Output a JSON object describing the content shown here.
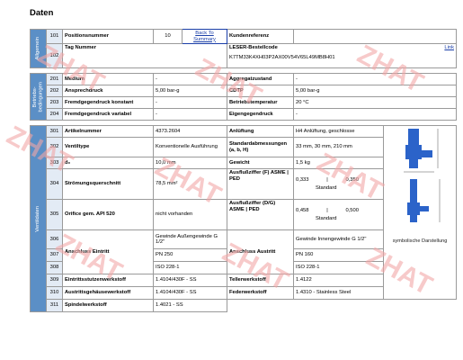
{
  "heading": "Daten",
  "watermark": "ZHAT",
  "groups": {
    "allgemein": "Allgemein",
    "betrieb": "Betriebs-\nbedingungen",
    "ventildaten": "Ventildaten"
  },
  "rows": {
    "r101": {
      "num": "101",
      "label": "Positionsnummer",
      "value": "10",
      "button": "Back To Summary",
      "label2": "Kundenreferenz",
      "value2": ""
    },
    "r102": {
      "num": "102",
      "label": "Tag Nummer",
      "value": "",
      "label2": "LESER-Bestellcode",
      "link": "Link",
      "value2": "K7TM33K4XH03P2AX00V54V65L49MB8H01"
    },
    "r201": {
      "num": "201",
      "label": "Medium",
      "value": "-",
      "label2": "Aggregatzustand",
      "value2": "-"
    },
    "r202": {
      "num": "202",
      "label": "Ansprechdruck",
      "value": "5,00 bar-g",
      "label2": "CDTP",
      "value2": "5,00 bar-g"
    },
    "r203": {
      "num": "203",
      "label": "Fremdgegendruck konstant",
      "value": "-",
      "label2": "Betriebstemperatur",
      "value2": "20 °C"
    },
    "r204": {
      "num": "204",
      "label": "Fremdgegendruck variabel",
      "value": "-",
      "label2": "Eigengegendruck",
      "value2": "-"
    },
    "r301": {
      "num": "301",
      "label": "Artikelnummer",
      "value": "4373.2604",
      "label2": "Anlüftung",
      "value2": "H4 Anlüftung, geschlosse"
    },
    "r302": {
      "num": "302",
      "label": "Ventiltype",
      "value": "Konventionelle Ausführung",
      "label2": "Standardabmessungen (a, b, H)",
      "value2": "33 mm, 30 mm, 210 mm"
    },
    "r303": {
      "num": "303",
      "label": "d₀",
      "value": "10,0 mm",
      "label2": "Gewicht",
      "value2": "1,5 kg"
    },
    "r304": {
      "num": "304",
      "label": "Strömungsquerschnitt",
      "value": "78,5 mm²",
      "label2": "Ausflußziffer (F) ASME | PED",
      "v2a": "0,333",
      "v2sep": "|",
      "v2b": "0,350",
      "v2c": "Standard"
    },
    "r305": {
      "num": "305",
      "label": "Orifice gem. API 520",
      "value": "nicht vorhanden",
      "label2": "Ausflußziffer (D/G) ASME | PED",
      "v2a": "0,458",
      "v2sep": "|",
      "v2b": "0,500",
      "v2c": "Standard"
    },
    "r306": {
      "num": "306",
      "value": "Gewinde Außengewinde G 1/2\"",
      "value2": "Gewinde Innengewinde G 1/2\""
    },
    "r307": {
      "num": "307",
      "label": "Anschluss Eintritt",
      "value": "PN 250",
      "label2": "Anschluss Austritt",
      "value2": "PN 160"
    },
    "r308": {
      "num": "308",
      "value": "ISO 228-1",
      "value2": "ISO 228-1"
    },
    "r309": {
      "num": "309",
      "label": "Eintrittsstutzenwerkstoff",
      "value": "1.4104/430F - SS",
      "label2": "Tellerwerkstoff",
      "value2": "1.4122"
    },
    "r310": {
      "num": "310",
      "label": "Austrittsgehäusewerkstoff",
      "value": "1.4104/430F - SS",
      "label2": "Federwerkstoff",
      "value2": "1.4310 - Stainless Steel"
    },
    "r311": {
      "num": "311",
      "label": "Spindelwerkstoff",
      "value": "1.4021 - SS"
    }
  },
  "image_caption": "symbolische Darstellung",
  "colors": {
    "group_band": "#5b8fc6",
    "num_cell": "#e3ebf5",
    "link": "#1a3ea8",
    "valve": "#2b63c9",
    "watermark": "#f2a7a7"
  }
}
